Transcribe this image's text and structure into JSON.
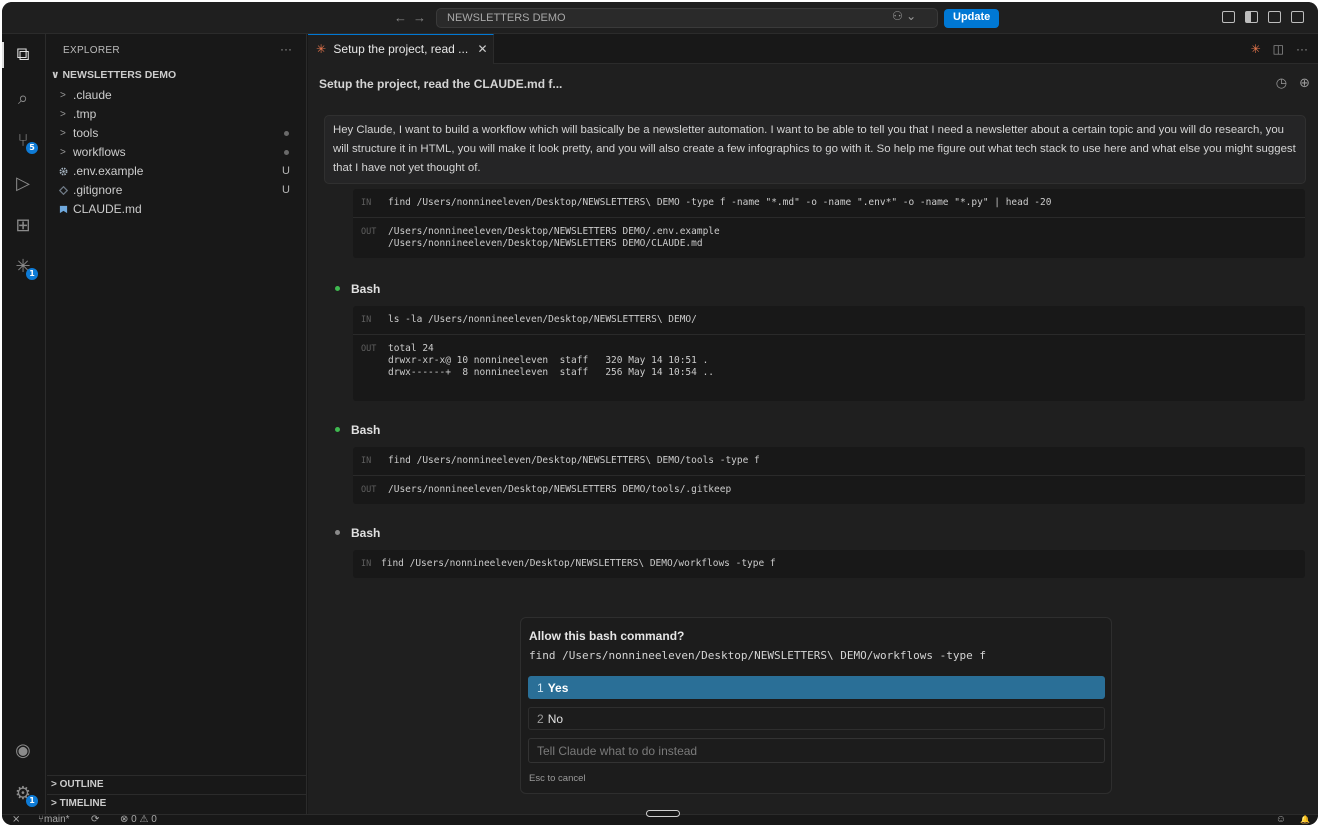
{
  "titlebar": {
    "search_text": "NEWSLETTERS DEMO",
    "update_label": "Update",
    "back_glyph": "←",
    "forward_glyph": "→",
    "copilot_glyph": "⚇ ⌄"
  },
  "activity_bar": {
    "items": [
      {
        "name": "explorer-icon",
        "glyph": "⧉"
      },
      {
        "name": "search-icon",
        "glyph": "⌕"
      },
      {
        "name": "source-control-icon",
        "glyph": "⑂",
        "badge": "5"
      },
      {
        "name": "run-debug-icon",
        "glyph": "▷"
      },
      {
        "name": "extensions-icon",
        "glyph": "⊞"
      },
      {
        "name": "claude-icon",
        "glyph": "✳",
        "badge": "1"
      }
    ],
    "account_glyph": "◉",
    "settings_glyph": "⚙",
    "settings_badge": "1"
  },
  "explorer": {
    "header": "EXPLORER",
    "more_glyph": "···",
    "root": "NEWSLETTERS DEMO",
    "root_chevron": "∨",
    "items": [
      {
        "label": ".claude",
        "type": "folder",
        "chevron": ">",
        "status": ""
      },
      {
        "label": ".tmp",
        "type": "folder",
        "chevron": ">",
        "status": ""
      },
      {
        "label": "tools",
        "type": "folder",
        "chevron": ">",
        "status": "dot"
      },
      {
        "label": "workflows",
        "type": "folder",
        "chevron": ">",
        "status": "dot"
      },
      {
        "label": ".env.example",
        "type": "file",
        "icon": "gear",
        "status": "U"
      },
      {
        "label": ".gitignore",
        "type": "file",
        "icon": "diamond",
        "status": "U"
      },
      {
        "label": "CLAUDE.md",
        "type": "file",
        "icon": "md",
        "status": ""
      }
    ],
    "outline_label": "OUTLINE",
    "timeline_label": "TIMELINE",
    "section_chevron": ">"
  },
  "editor": {
    "tab_label": "Setup the project, read ...",
    "tab_close": "✕",
    "tab_icon": "✳",
    "split_glyph": "◫",
    "more_glyph": "···",
    "conversation_title": "Setup the project, read the CLAUDE.md f...",
    "history_glyph": "◷",
    "new_glyph": "⊕"
  },
  "conversation": {
    "user_message": "Hey Claude, I want to build a workflow which will basically be a newsletter automation. I want to be able to tell you that I need a newsletter about a certain topic and you will do research, you will structure it in HTML, you will make it look pretty, and you will also create a few infographics to go with it. So help me figure out what tech stack to use here and what else you might suggest that I have not yet thought of.",
    "in_tag": "IN",
    "out_tag": "OUT",
    "blocks": [
      {
        "in": "find /Users/nonnineeleven/Desktop/NEWSLETTERS\\ DEMO -type f -name \"*.md\" -o -name \".env*\" -o -name \"*.py\" | head -20",
        "out": "/Users/nonnineeleven/Desktop/NEWSLETTERS DEMO/.env.example\n/Users/nonnineeleven/Desktop/NEWSLETTERS DEMO/CLAUDE.md"
      },
      {
        "title": "Bash",
        "in": "ls -la /Users/nonnineeleven/Desktop/NEWSLETTERS\\ DEMO/",
        "out": "total 24\ndrwxr-xr-x@ 10 nonnineeleven  staff   320 May 14 10:51 .\ndrwx------+  8 nonnineeleven  staff   256 May 14 10:54 .."
      },
      {
        "title": "Bash",
        "in": "find /Users/nonnineeleven/Desktop/NEWSLETTERS\\ DEMO/tools -type f",
        "out": "/Users/nonnineeleven/Desktop/NEWSLETTERS DEMO/tools/.gitkeep"
      },
      {
        "title": "Bash",
        "in": "find /Users/nonnineeleven/Desktop/NEWSLETTERS\\ DEMO/workflows -type f"
      }
    ],
    "dot_colors": {
      "done": "#3fb950",
      "pending": "#8a8a8a"
    }
  },
  "permission": {
    "title": "Allow this bash command?",
    "command": "find /Users/nonnineeleven/Desktop/NEWSLETTERS\\ DEMO/workflows -type f",
    "options": [
      {
        "num": "1",
        "label": "Yes"
      },
      {
        "num": "2",
        "label": "No"
      }
    ],
    "input_placeholder": "Tell Claude what to do instead",
    "hint": "Esc to cancel"
  },
  "statusbar": {
    "remote_glyph": "⨯",
    "branch": "main*",
    "branch_glyph": "⑂",
    "sync_glyph": "⟳",
    "errors": "0",
    "warnings": "0",
    "error_glyph": "⊗",
    "warning_glyph": "⚠",
    "copilot_glyph": "☺",
    "bell_glyph": "🔔"
  }
}
